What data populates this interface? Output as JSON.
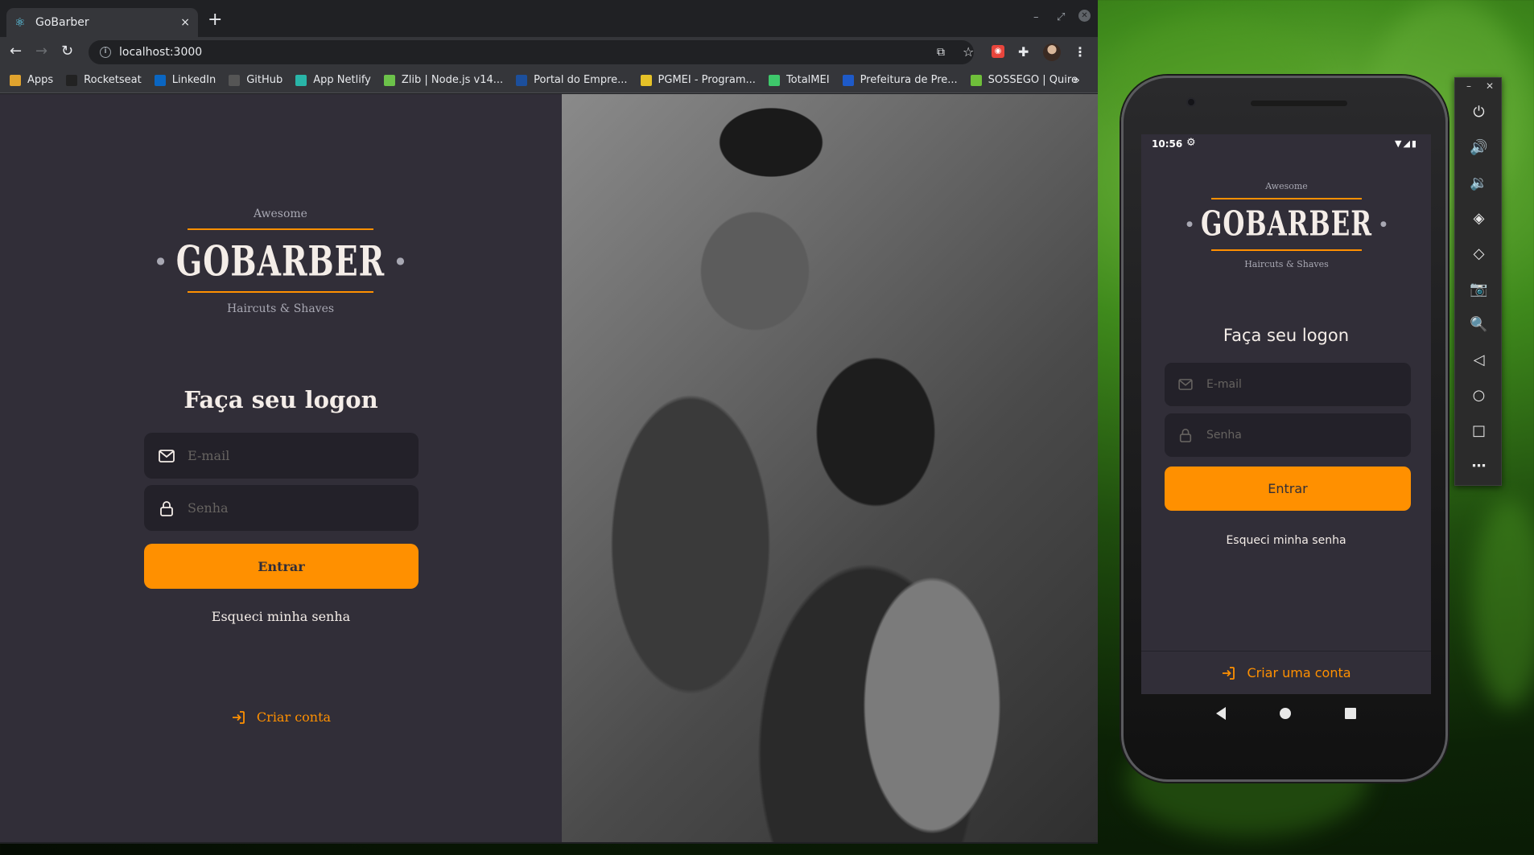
{
  "browser": {
    "tab_title": "GoBarber",
    "tab_close": "×",
    "new_tab": "+",
    "address": "localhost:3000",
    "bookmarks": [
      {
        "label": "Apps",
        "color": "#e0a32e"
      },
      {
        "label": "Rocketseat",
        "color": "#222222"
      },
      {
        "label": "LinkedIn",
        "color": "#0a66c2"
      },
      {
        "label": "GitHub",
        "color": "#555555"
      },
      {
        "label": "App Netlify",
        "color": "#29b5a8"
      },
      {
        "label": "Zlib | Node.js v14...",
        "color": "#6cc24a"
      },
      {
        "label": "Portal do Empre...",
        "color": "#1c4f9c"
      },
      {
        "label": "PGMEI - Program...",
        "color": "#e6c228"
      },
      {
        "label": "TotalMEI",
        "color": "#3ec86b"
      },
      {
        "label": "Prefeitura de Pre...",
        "color": "#1e5ac8"
      },
      {
        "label": "SOSSEGO | Quire",
        "color": "#6fbf3a"
      }
    ],
    "bookmarks_more": "»"
  },
  "web": {
    "logo": {
      "top": "Awesome",
      "brand": "GOBARBER",
      "bottom": "Haircuts & Shaves"
    },
    "title": "Faça seu logon",
    "email_placeholder": "E-mail",
    "password_placeholder": "Senha",
    "submit": "Entrar",
    "forgot": "Esqueci minha senha",
    "create": "Criar conta"
  },
  "phone": {
    "time": "10:56",
    "logo": {
      "top": "Awesome",
      "brand": "GOBARBER",
      "bottom": "Haircuts & Shaves"
    },
    "title": "Faça seu logon",
    "email_placeholder": "E-mail",
    "password_placeholder": "Senha",
    "submit": "Entrar",
    "forgot": "Esqueci minha senha",
    "create": "Criar uma conta"
  },
  "colors": {
    "accent": "#ff9000",
    "background": "#312e38",
    "input": "#232129",
    "text": "#f4ede8",
    "muted": "#666360"
  },
  "emulator_icons": [
    "power-icon",
    "volume-up-icon",
    "volume-down-icon",
    "rotate-left-icon",
    "rotate-right-icon",
    "camera-icon",
    "zoom-icon",
    "back-icon",
    "home-icon",
    "overview-icon",
    "more-icon"
  ]
}
